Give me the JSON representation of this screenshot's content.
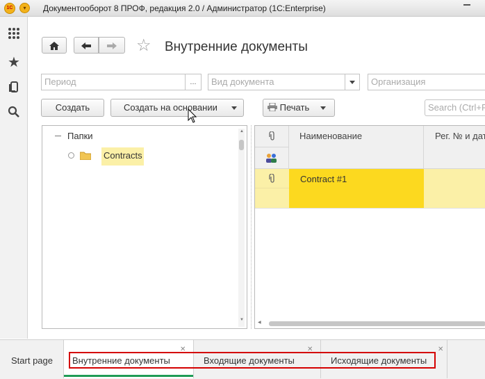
{
  "window": {
    "title": "Документооборот 8 ПРОФ, редакция 2.0 / Администратор  (1C:Enterprise)",
    "logo_text": "1C"
  },
  "sidebar": {
    "icons": [
      "grid-menu-icon",
      "star-icon",
      "history-icon",
      "search-icon"
    ]
  },
  "page": {
    "title": "Внутренние документы"
  },
  "filters": {
    "period_placeholder": "Период",
    "period_btn": "...",
    "doc_type_placeholder": "Вид документа",
    "org_placeholder": "Организация"
  },
  "toolbar": {
    "create": "Создать",
    "create_based": "Создать на основании",
    "print": "Печать",
    "search_placeholder": "Search (Ctrl+F)"
  },
  "tree": {
    "root": "Папки",
    "folder": "Contracts"
  },
  "grid": {
    "col_name": "Наименование",
    "col_reg": "Рег. № и дата",
    "rows": [
      {
        "name": "Contract #1"
      }
    ]
  },
  "tabs": {
    "start": "Start page",
    "items": [
      "Внутренние документы",
      "Входящие документы",
      "Исходящие документы"
    ]
  },
  "colors": {
    "selected_row": "#fcd91f",
    "selected_light": "#fbf0a7",
    "active_tab_underline": "#1f9c56",
    "highlight_box": "#d40000"
  }
}
